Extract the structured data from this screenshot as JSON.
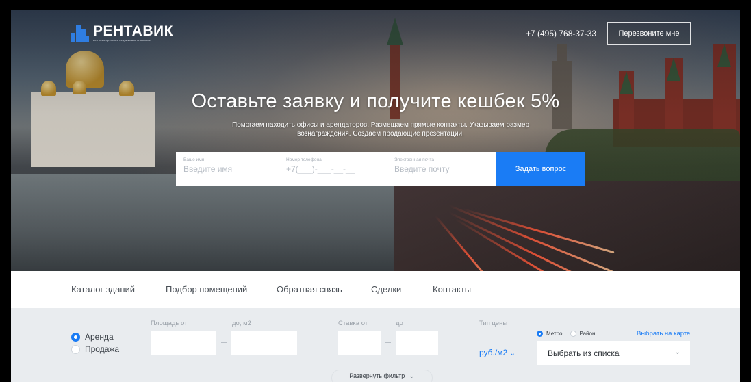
{
  "brand": {
    "name": "РЕНТАВИК",
    "tagline": "вся коммерческая недвижимость москвы"
  },
  "header": {
    "phone": "+7 (495) 768-37-33",
    "callback_label": "Перезвоните мне"
  },
  "hero": {
    "title": "Оставьте заявку и получите кешбек 5%",
    "subtitle": "Помогаем находить офисы и арендаторов. Размещаем прямые контакты. Указываем размер вознаграждения. Создаем продающие презентации."
  },
  "form": {
    "name_label": "Ваше имя",
    "name_placeholder": "Введите имя",
    "phone_label": "Номер телефона",
    "phone_placeholder": "+7(___)-___-__-__",
    "email_label": "Электронная почта",
    "email_placeholder": "Введите почту",
    "submit_label": "Задать вопрос"
  },
  "nav": {
    "items": [
      "Каталог зданий",
      "Подбор помещений",
      "Обратная связь",
      "Сделки",
      "Контакты"
    ]
  },
  "filter": {
    "deal_types": [
      {
        "label": "Аренда",
        "selected": true
      },
      {
        "label": "Продажа",
        "selected": false
      }
    ],
    "area_from_label": "Площадь от",
    "area_to_label": "до, м2",
    "rate_from_label": "Ставка от",
    "rate_to_label": "до",
    "price_type_label": "Тип цены",
    "price_type_value": "руб./м2",
    "location_types": [
      {
        "label": "Метро",
        "selected": true
      },
      {
        "label": "Район",
        "selected": false
      }
    ],
    "map_link": "Выбрать на карте",
    "select_value": "Выбрать из списка",
    "expand_label": "Развернуть фильтр"
  },
  "colors": {
    "accent": "#1a7cf5",
    "nav_text": "#4b5158",
    "filter_bg": "#e9ecef"
  }
}
